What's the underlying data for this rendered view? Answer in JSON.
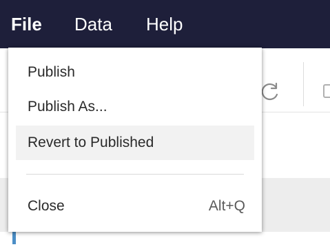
{
  "menubar": {
    "items": [
      {
        "label": "File"
      },
      {
        "label": "Data"
      },
      {
        "label": "Help"
      }
    ]
  },
  "file_menu": {
    "items": [
      {
        "label": "Publish"
      },
      {
        "label": "Publish As..."
      },
      {
        "label": "Revert to Published",
        "highlighted": true
      },
      {
        "label": "Close",
        "shortcut": "Alt+Q"
      }
    ]
  },
  "colors": {
    "menubar_bg": "#1e1f3a",
    "highlight_bg": "#f2f2f2",
    "accent": "#4b8ec6"
  },
  "icons": [
    "refresh-icon",
    "toolbar-icon"
  ]
}
